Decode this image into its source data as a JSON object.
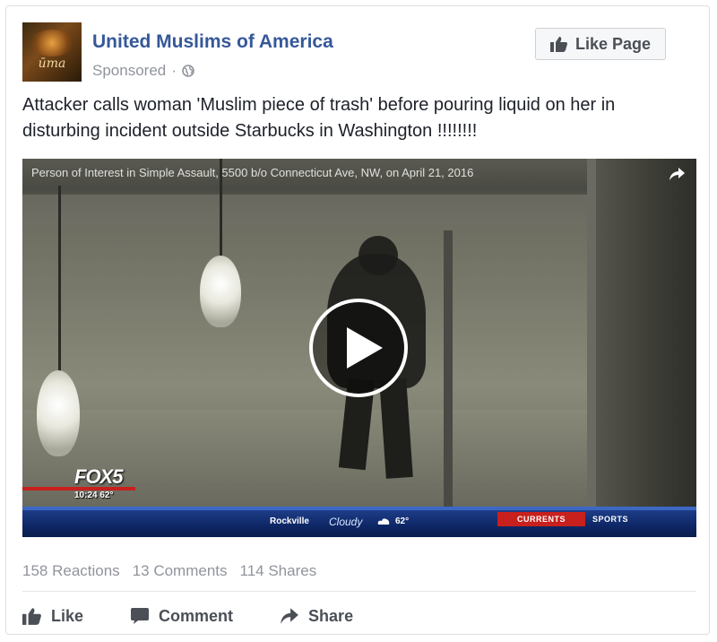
{
  "post": {
    "page_name": "United Muslims of America",
    "avatar_text": "ūma",
    "sponsored": "Sponsored",
    "separator": "·",
    "like_page_label": "Like Page",
    "text": "Attacker calls woman 'Muslim piece of trash' before pouring liquid on her in disturbing incident outside Starbucks in Washington !!!!!!!!"
  },
  "video": {
    "caption": "Person of Interest in Simple Assault, 5500 b/o Connecticut Ave, NW, on April 21, 2016",
    "station": "FOX5",
    "time": "10:24",
    "temp_small": "62°",
    "ticker": {
      "city": "Rockville",
      "condition": "Cloudy",
      "temp": "62°",
      "tab1": "CURRENTS",
      "tab2": "SPORTS"
    }
  },
  "stats": {
    "reactions": "158 Reactions",
    "comments": "13 Comments",
    "shares": "114 Shares"
  },
  "actions": {
    "like": "Like",
    "comment": "Comment",
    "share": "Share"
  },
  "colors": {
    "link_blue": "#365899",
    "meta_gray": "#90949c",
    "action_gray": "#4b4f56"
  },
  "icons": {
    "like_page": "thumbs-up-icon",
    "globe": "globe-icon",
    "play": "play-icon",
    "video_share": "share-arrow-icon",
    "like": "thumbs-up-icon",
    "comment": "comment-icon",
    "share": "share-arrow-icon"
  }
}
